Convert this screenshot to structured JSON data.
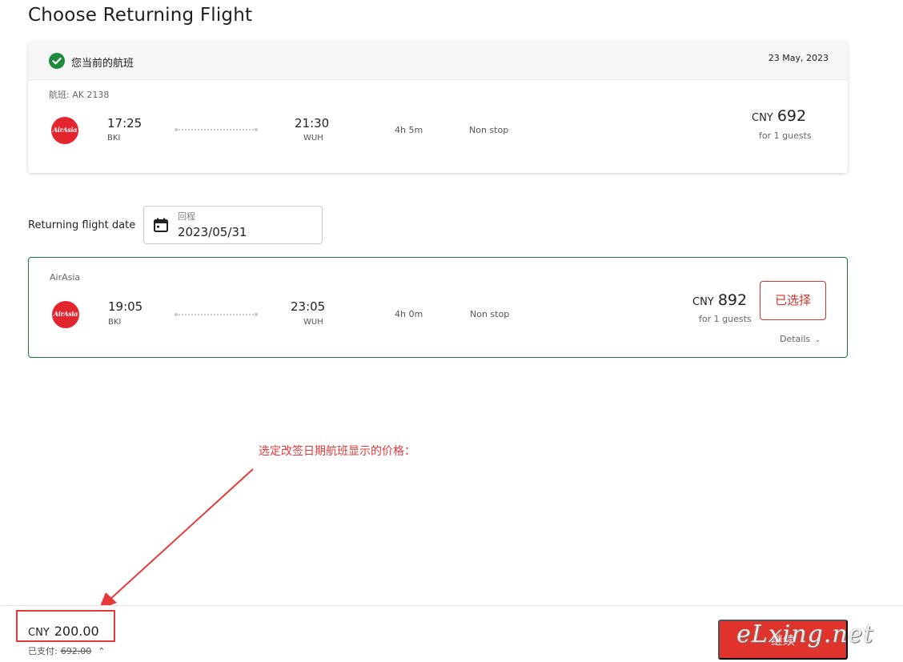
{
  "page": {
    "title": "Choose Returning Flight"
  },
  "current_flight": {
    "label": "您当前的航班",
    "date": "23 May, 2023",
    "flight_no": "航班: AK 2138",
    "logo_text": "AirAsia",
    "depart_time": "17:25",
    "depart_code": "BKI",
    "arrive_time": "21:30",
    "arrive_code": "WUH",
    "duration": "4h 5m",
    "stops": "Non stop",
    "currency": "CNY",
    "price": "692",
    "guests": "for 1 guests"
  },
  "return_date": {
    "label": "Returning flight date",
    "placeholder": "回程",
    "value": "2023/05/31"
  },
  "return_flight": {
    "airline": "AirAsia",
    "logo_text": "AirAsia",
    "depart_time": "19:05",
    "depart_code": "BKI",
    "arrive_time": "23:05",
    "arrive_code": "WUH",
    "duration": "4h 0m",
    "stops": "Non stop",
    "currency": "CNY",
    "price": "892",
    "guests": "for 1 guests",
    "select_label": "已选择",
    "details_label": "Details"
  },
  "annotation": {
    "text": "选定改签日期航班显示的价格：",
    "color": "#e53a3a"
  },
  "bottom": {
    "currency": "CNY",
    "total": "200.00",
    "paid_label": "已支付:",
    "paid_amount": "692.00",
    "continue_label": "继续",
    "watermark": "eLxing.net"
  },
  "colors": {
    "accent_red": "#e0332c",
    "success_green": "#1d8a3c",
    "card_border_green": "#1d7a3a"
  }
}
